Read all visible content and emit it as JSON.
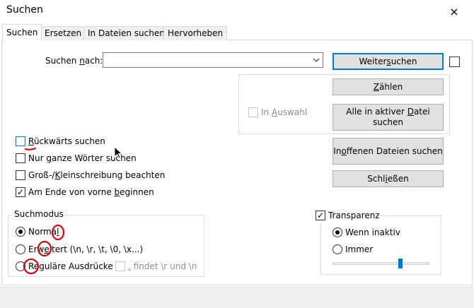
{
  "window": {
    "title": "Suchen",
    "close_icon": "×"
  },
  "tabs": [
    {
      "label": "Suchen",
      "active": true
    },
    {
      "label": "Ersetzen"
    },
    {
      "label": "In Dateien suchen"
    },
    {
      "label": "Hervorheben"
    }
  ],
  "search": {
    "label_pre": "Suchen ",
    "label_u": "n",
    "label_post": "ach:",
    "value": ""
  },
  "buttons": {
    "find_next": {
      "pre": "Weiter ",
      "u": "s",
      "post": "uchen"
    },
    "count": {
      "pre": "",
      "u": "Z",
      "post": "ählen"
    },
    "find_all_active_l1_pre": "Alle in aktiver ",
    "find_all_active_u": "D",
    "find_all_active_l1_post": "atei",
    "find_all_active_l2": "suchen",
    "find_all_open": {
      "pre": "In ",
      "u": "o",
      "post": "ffenen Dateien suchen"
    },
    "close": {
      "pre": "Schl",
      "u": "i",
      "post": "eßen"
    }
  },
  "in_selection": {
    "pre": "In ",
    "u": "A",
    "post": "uswahl",
    "checked": false,
    "enabled": false
  },
  "options": {
    "backward": {
      "pre": "",
      "u": "R",
      "post": "ückwärts suchen",
      "checked": false
    },
    "whole_words": {
      "pre": "Nur ",
      "u": "g",
      "post": "anze Wörter suchen",
      "checked": false
    },
    "match_case": {
      "pre": "Groß-/",
      "u": "K",
      "post": "leinschreibung beachten",
      "checked": false
    },
    "wrap": {
      "pre": "Am Ende von vorne ",
      "u": "b",
      "post": "eginnen",
      "checked": true,
      "check_mark": "✓"
    }
  },
  "search_mode": {
    "title": "Suchmodus",
    "normal": {
      "pre": "Norma",
      "u": "l",
      "post": "",
      "selected": true
    },
    "extended": {
      "pre": "Erw",
      "u": "e",
      "post": "itert (\\n, \\r, \\t, \\0, \\x...)",
      "selected": false
    },
    "regex": {
      "pre": "Re",
      "u": "g",
      "post": "uläre Ausdrücke",
      "selected": false
    },
    "dot_newline": {
      "pre": "",
      "u": ".",
      "post": " findet \\r und \\n",
      "checked": false,
      "enabled": false
    }
  },
  "transparency": {
    "title": "Transparenz",
    "checked": true,
    "check_mark": "✓",
    "when_inactive": {
      "label": "Wenn inaktiv",
      "selected": true
    },
    "always": {
      "label": "Immer",
      "selected": false
    },
    "slider_level": 0.71
  },
  "colors": {
    "accent": "#0078d7",
    "annotation_red": "#e0000b"
  }
}
